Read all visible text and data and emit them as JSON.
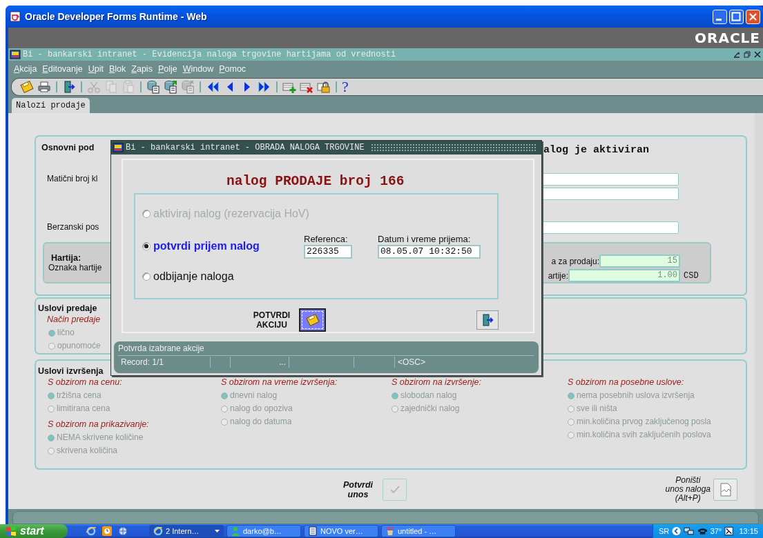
{
  "window": {
    "title": "Oracle Developer Forms Runtime - Web",
    "brand": "ORACLE"
  },
  "form_window": {
    "title": "Bi - bankarski intranet - Evidencija naloga trgovine hartijama od vrednosti"
  },
  "menu": [
    "Akcija",
    "Editovanje",
    "Upit",
    "Blok",
    "Zapis",
    "Polje",
    "Window",
    "Pomoc"
  ],
  "toolbar": [
    {
      "kind": "save",
      "disabled": false
    },
    {
      "kind": "print",
      "disabled": false
    },
    {
      "kind": "separator"
    },
    {
      "kind": "exit",
      "disabled": false
    },
    {
      "kind": "separator"
    },
    {
      "kind": "cut",
      "disabled": true
    },
    {
      "kind": "copy",
      "disabled": true
    },
    {
      "kind": "paste",
      "disabled": true
    },
    {
      "kind": "separator"
    },
    {
      "kind": "query",
      "disabled": false
    },
    {
      "kind": "execute",
      "disabled": false
    },
    {
      "kind": "cancel",
      "disabled": true
    },
    {
      "kind": "separator"
    },
    {
      "kind": "first",
      "disabled": false
    },
    {
      "kind": "previous",
      "disabled": false
    },
    {
      "kind": "next",
      "disabled": false
    },
    {
      "kind": "last",
      "disabled": false
    },
    {
      "kind": "separator"
    },
    {
      "kind": "insert",
      "disabled": false
    },
    {
      "kind": "delete",
      "disabled": false
    },
    {
      "kind": "lock",
      "disabled": false
    },
    {
      "kind": "separator"
    },
    {
      "kind": "help",
      "label": "?",
      "disabled": false
    }
  ],
  "tabs": [
    {
      "label": "Nalozi prodaje",
      "selected": true
    }
  ],
  "basic_panel": {
    "title": "Osnovni pod",
    "status": "alog je aktiviran",
    "client_label": "Matični broj kl",
    "exchange_label": "Berzanski pos",
    "security": {
      "title": "Hartija:",
      "code_label": "Oznaka hartije",
      "quantity_label": "a za prodaju:",
      "quantity": "15",
      "price_label": "artije:",
      "price": "1.00",
      "currency": "CSD"
    }
  },
  "delivery_panel": {
    "title": "Uslovi predaje",
    "group": {
      "title": "Način predaje",
      "disabled": true,
      "options": [
        {
          "label": "lično",
          "selected": true
        },
        {
          "label": "opunomoće",
          "selected": false
        }
      ]
    }
  },
  "execution_panel": {
    "title": "Uslovi izvršenja",
    "columns": [
      {
        "groups": [
          {
            "title": "S obzirom na cenu:",
            "disabled": true,
            "options": [
              {
                "label": "tržišna cena",
                "selected": true
              },
              {
                "label": "limitirana cena",
                "selected": false
              }
            ]
          },
          {
            "title": "S obzirom na prikazivanje:",
            "disabled": true,
            "options": [
              {
                "label": "NEMA skrivene količine",
                "selected": true
              },
              {
                "label": "skrivena količina",
                "selected": false
              }
            ]
          }
        ]
      },
      {
        "groups": [
          {
            "title": "S obzirom na vreme izvršenja:",
            "disabled": true,
            "options": [
              {
                "label": "dnevni nalog",
                "selected": true
              },
              {
                "label": "nalog do opoziva",
                "selected": false
              },
              {
                "label": "nalog do datuma",
                "selected": false
              }
            ]
          }
        ]
      },
      {
        "groups": [
          {
            "title": "S obzirom na izvršenje:",
            "disabled": true,
            "options": [
              {
                "label": "slobodan nalog",
                "selected": true
              },
              {
                "label": "zajednički nalog",
                "selected": false
              }
            ]
          }
        ]
      },
      {
        "groups": [
          {
            "title": "S obzirom na posebne uslove:",
            "disabled": true,
            "options": [
              {
                "label": "nema posebnih uslova izvršenja",
                "selected": true
              },
              {
                "label": "sve ili ništa",
                "selected": false
              },
              {
                "label": "min.količina prvog zaključenog posla",
                "selected": false
              },
              {
                "label": "min.količina svih zaključenih poslova",
                "selected": false
              }
            ]
          }
        ]
      }
    ]
  },
  "confirm_entry": {
    "label": "Potvrdi\nunos",
    "disabled": true
  },
  "cancel_entry": {
    "label": "Poništi\nunos naloga\n(Alt+P)"
  },
  "dialog": {
    "title": "Bi - bankarski intranet - OBRADA NALOGA TRGOVINE",
    "heading": "nalog PRODAJE broj 166",
    "actions": [
      {
        "label": "aktiviraj nalog (rezervacija HoV)",
        "selected": false,
        "disabled": true
      },
      {
        "label": "potvrdi prijem nalog",
        "selected": true,
        "disabled": false
      },
      {
        "label": "odbijanje naloga",
        "selected": false,
        "disabled": false
      }
    ],
    "reference": {
      "label": "Referenca:",
      "value": "226335"
    },
    "received": {
      "label": "Datum i vreme prijema:",
      "value": "08.05.07 10:32:50"
    },
    "confirm_label": "POTVRDI\nAKCIJU",
    "status": {
      "hint": "Potvrda izabrane akcije",
      "record": "Record: 1/1",
      "more": "...",
      "mode": "<OSC>"
    }
  },
  "taskbar": {
    "start": "start",
    "tasks": [
      {
        "kind": "browser",
        "label": "2 Intern…",
        "selected": true,
        "grouped": true
      },
      {
        "kind": "chat",
        "label": "darko@b…",
        "selected": false,
        "grouped": false
      },
      {
        "kind": "document",
        "label": "NOVO ver…",
        "selected": false,
        "grouped": false
      },
      {
        "kind": "paint",
        "label": "untitled - …",
        "selected": false,
        "grouped": false
      }
    ],
    "language": "SR",
    "temperature": "37°",
    "clock": "13:15"
  }
}
